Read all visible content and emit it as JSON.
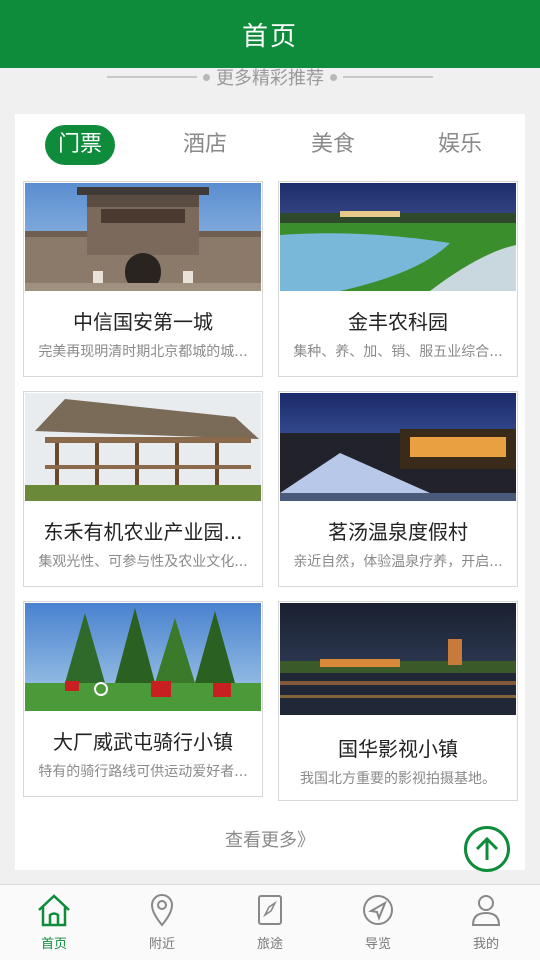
{
  "header": {
    "title": "首页"
  },
  "section": {
    "subtitle": "更多精彩推荐"
  },
  "tabs": [
    {
      "label": "门票",
      "active": true
    },
    {
      "label": "酒店",
      "active": false
    },
    {
      "label": "美食",
      "active": false
    },
    {
      "label": "娱乐",
      "active": false
    }
  ],
  "items": [
    {
      "title": "中信国安第一城",
      "desc": "完美再现明清时期北京都城的城...",
      "image": "city-gate"
    },
    {
      "title": "金丰农科园",
      "desc": "集种、养、加、销、服五业综合...",
      "image": "farm-lake"
    },
    {
      "title": "东禾有机农业产业园...",
      "desc": "集观光性、可参与性及农业文化...",
      "image": "pavilion"
    },
    {
      "title": "茗汤温泉度假村",
      "desc": "亲近自然，体验温泉疗养，开启...",
      "image": "hot-spring"
    },
    {
      "title": "大厂威武屯骑行小镇",
      "desc": "特有的骑行路线可供运动爱好者...",
      "image": "cycling-town"
    },
    {
      "title": "国华影视小镇",
      "desc": "我国北方重要的影视拍摄基地。",
      "image": "film-town"
    }
  ],
  "more": {
    "label": "查看更多》"
  },
  "bottom_nav": [
    {
      "label": "首页",
      "icon": "home-icon",
      "active": true
    },
    {
      "label": "附近",
      "icon": "location-pin-icon",
      "active": false
    },
    {
      "label": "旅途",
      "icon": "map-icon",
      "active": false
    },
    {
      "label": "导览",
      "icon": "navigation-icon",
      "active": false
    },
    {
      "label": "我的",
      "icon": "user-icon",
      "active": false
    }
  ],
  "colors": {
    "primary": "#0e8c3c",
    "text_muted": "#8a8a8a"
  }
}
